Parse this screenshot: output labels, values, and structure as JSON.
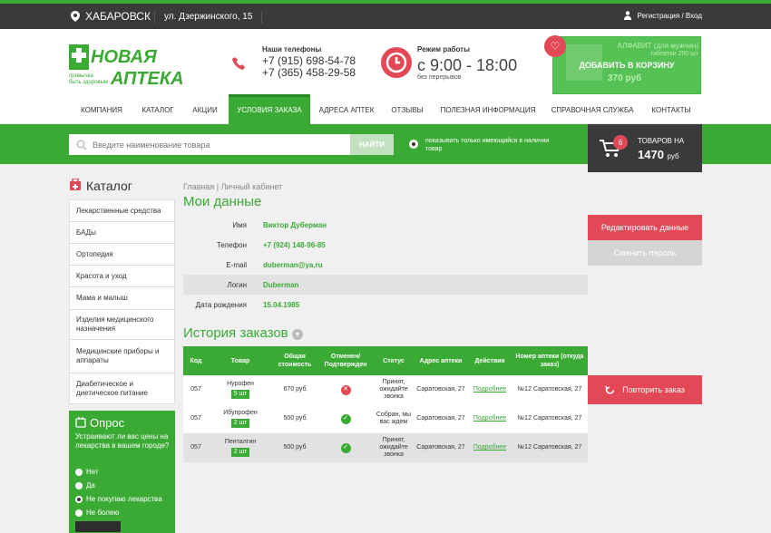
{
  "topbar": {
    "city": "ХАБАРОВСК",
    "address": "ул. Дзержинского, 15",
    "auth": "Регистрация / Вход"
  },
  "header": {
    "logo_text": "НОВАЯ АПТЕКА",
    "logo_slogan": "привычка быть здоровым",
    "phones_title": "Наши телефоны",
    "phone1": "+7 (915) 698-54-78",
    "phone2": "+7 (365) 458-29-58",
    "work_title": "Режим работы",
    "work_hours": "с 9:00 - 18:00",
    "work_note": "без перерывов"
  },
  "promo": {
    "name": "АЛФАВИТ (для мужчин)",
    "sub": "таблетки 200 шт",
    "cart_label": "ДОБАВИТЬ В КОРЗИНУ",
    "price": "370 руб"
  },
  "nav": [
    "КОМПАНИЯ",
    "КАТАЛОГ",
    "АКЦИИ",
    "УСЛОВИЯ ЗАКАЗА",
    "АДРЕСА АПТЕК",
    "ОТЗЫВЫ",
    "ПОЛЕЗНАЯ ИНФОРМАЦИЯ",
    "СПРАВОЧНАЯ СЛУЖБА",
    "КОНТАКТЫ"
  ],
  "search": {
    "placeholder": "Введите наименование товара",
    "button": "НАЙТИ",
    "only_available": "показывать только имеющийся в наличии товар"
  },
  "cart": {
    "count": "6",
    "title": "ТОВАРОВ НА",
    "sum": "1470",
    "currency": "руб"
  },
  "catalog": {
    "title": "Каталог",
    "items": [
      "Лекарственные средства",
      "БАДы",
      "Ортопедия",
      "Красота и уход",
      "Мама и малыш",
      "Изделия медицинского назначения",
      "Медицинские приборы и аппараты",
      "Диабетическое и диетическое питание"
    ]
  },
  "poll": {
    "title": "Опрос",
    "question": "Устраивают ли вас цены на лекарства в вашем городе?",
    "options": [
      "Нет",
      "Да",
      "Не покупаю лекарства",
      "Не болею"
    ],
    "selected": 2
  },
  "breadcrumb": "Главная | Личный кабинет",
  "mydata": {
    "title": "Мои данные",
    "rows": [
      {
        "label": "Имя",
        "value": "Виктор Дуберман"
      },
      {
        "label": "Телефон",
        "value": "+7 (924) 148-96-85"
      },
      {
        "label": "E-mail",
        "value": "duberman@ya.ru"
      },
      {
        "label": "Логин",
        "value": "Duberman"
      },
      {
        "label": "Дата рождения",
        "value": "15.04.1985"
      }
    ],
    "edit_button": "Редактировать данные",
    "password_button": "Сменить пароль"
  },
  "history": {
    "title": "История заказов",
    "headers": [
      "Код",
      "Товар",
      "Общая стоимость",
      "Отменен/ Подтвержден",
      "Статус",
      "Адрес аптеки",
      "Действия",
      "Номер аптеки (откуда заказ)"
    ],
    "rows": [
      {
        "code": "057",
        "product": "Нурофен",
        "qty": "5 шт",
        "cost": "670 руб",
        "state": "cancelled",
        "status": "Принят, ожидайте звонка",
        "address": "Саратовская, 27",
        "action": "Подробнее",
        "pharmacy": "№12 Саратовская, 27"
      },
      {
        "code": "057",
        "product": "Ибупрофен",
        "qty": "2 шт",
        "cost": "500 руб",
        "state": "confirmed",
        "status": "Собран, мы вас ждем",
        "address": "Саратовская, 27",
        "action": "Подробнее",
        "pharmacy": "№12 Саратовская, 27"
      },
      {
        "code": "057",
        "product": "Пенталгин",
        "qty": "2 шт",
        "cost": "500 руб",
        "state": "confirmed",
        "status": "Принят, ожидайте звонка",
        "address": "Саратовская, 27",
        "action": "Подробнее",
        "pharmacy": "№12 Саратовская, 27"
      }
    ],
    "repeat_button": "Повторить заказ"
  },
  "colors": {
    "green": "#3aaa35",
    "red": "#e34856",
    "dark": "#3a3a3a"
  }
}
